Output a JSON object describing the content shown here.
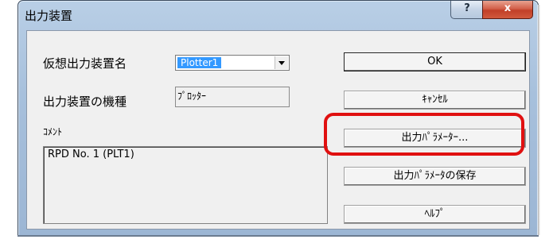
{
  "window": {
    "title": "出力装置",
    "help_glyph": "?",
    "close_glyph": "x"
  },
  "form": {
    "virtual_device_label": "仮想出力装置名",
    "virtual_device_value": "Plotter1",
    "device_type_label": "出力装置の機種",
    "device_type_value": "ﾌﾟﾛｯﾀｰ",
    "comment_label": "ｺﾒﾝﾄ",
    "comment_value": "RPD No. 1 (PLT1)"
  },
  "buttons": {
    "ok": "OK",
    "cancel": "ｷｬﾝｾﾙ",
    "output_params": "出力ﾊﾟﾗﾒｰﾀｰ...",
    "save_params": "出力ﾊﾟﾗﾒｰﾀの保存",
    "help": "ﾍﾙﾌﾟ"
  },
  "colors": {
    "highlight": "#e01010",
    "selection": "#3399ff"
  }
}
